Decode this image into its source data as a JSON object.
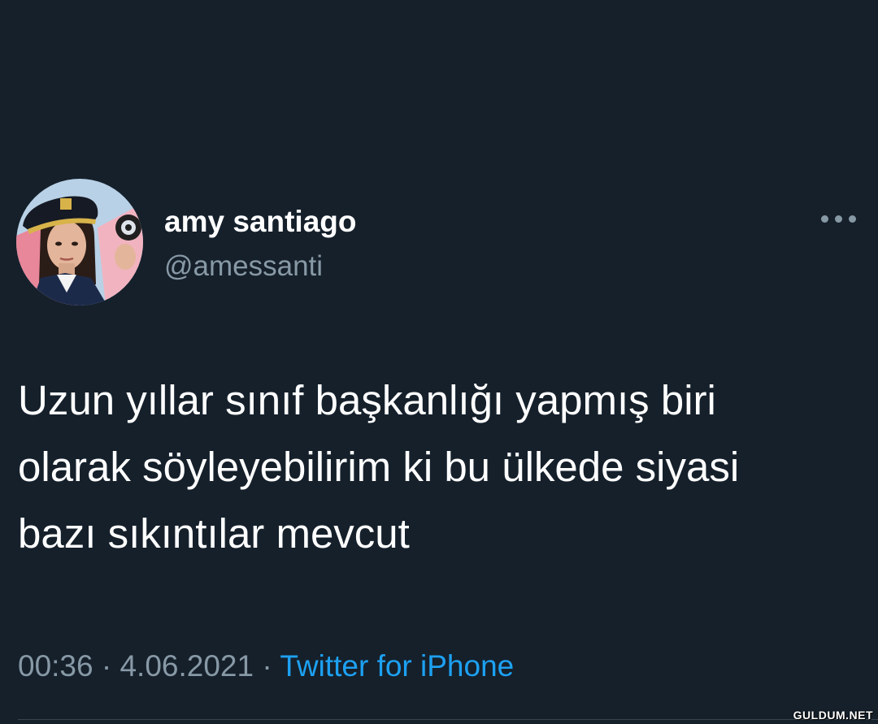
{
  "tweet": {
    "author": {
      "display_name": "amy santiago",
      "handle": "@amessanti",
      "avatar": "profile-photo-police-captain-hat"
    },
    "more_icon": "more-dots-icon",
    "text_lines": [
      "Uzun yıllar sınıf başkanlığı yapmış biri",
      "olarak söyleyebilirim ki bu ülkede siyasi",
      "bazı sıkıntılar mevcut"
    ],
    "time": "00:36",
    "separator": "·",
    "date": "4.06.2021",
    "source": "Twitter for iPhone"
  },
  "watermark": "GULDUM.NET",
  "colors": {
    "background": "#15202b",
    "primary_text": "#ffffff",
    "secondary_text": "#8899a6",
    "link": "#1da1f2",
    "divider": "#38444d"
  }
}
